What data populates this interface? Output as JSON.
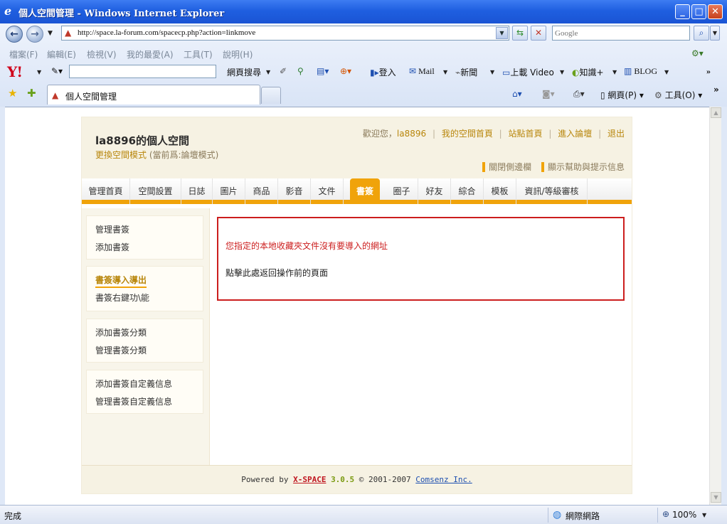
{
  "window": {
    "title": "個人空間管理 - Windows Internet Explorer"
  },
  "address": {
    "url": "http://space.la-forum.com/spacecp.php?action=linkmove",
    "search_placeholder": "Google"
  },
  "menu": {
    "items": [
      "檔案(F)",
      "編輯(E)",
      "檢視(V)",
      "我的最愛(A)",
      "工具(T)",
      "說明(H)"
    ]
  },
  "yahoo_toolbar": {
    "logo": "Y!",
    "web_search": "網頁搜尋",
    "signin": "登入",
    "mail": "Mail",
    "news": "新聞",
    "video": "上載 Video",
    "knowledge": "知識+",
    "blog": "BLOG",
    "more": "»"
  },
  "tabs": {
    "active_label": "個人空間管理",
    "page_cmd": "網頁(P)",
    "tools_cmd": "工具(O)"
  },
  "site": {
    "title": "la8896的個人空間",
    "change_mode": "更換空間模式",
    "current_mode": "(當前爲:論壇模式)",
    "greeting": "歡迎您，",
    "username": "la8896",
    "links": [
      "我的空間首頁",
      "站點首頁",
      "進入論壇",
      "退出"
    ],
    "toggles": [
      "關閉側邊欄",
      "顯示幫助與提示信息"
    ],
    "nav": [
      "管理首頁",
      "空間設置",
      "日誌",
      "圖片",
      "商品",
      "影音",
      "文件",
      "書簽",
      "圈子",
      "好友",
      "綜合",
      "模板",
      "資訊/等級審核"
    ],
    "nav_active_index": 7,
    "sidebar_groups": [
      {
        "items": [
          "管理書簽",
          "添加書簽"
        ]
      },
      {
        "items": [
          "書簽導入導出",
          "書簽右鍵功\\能"
        ]
      },
      {
        "items": [
          "添加書簽分類",
          "管理書簽分類"
        ]
      },
      {
        "items": [
          "添加書簽自定義信息",
          "管理書簽自定義信息"
        ]
      }
    ],
    "sidebar_current": "書簽導入導出",
    "message": {
      "error": "您指定的本地收藏夾文件沒有要導入的網址",
      "back": "點擊此處返回操作前的頁面"
    },
    "footer": {
      "powered": "Powered by ",
      "brand": "X-SPACE",
      "version": "3.0.5",
      "copyright": " © 2001-2007 ",
      "company": "Comsenz Inc."
    }
  },
  "status": {
    "text": "完成",
    "zone": "網際網路",
    "zoom": "100%"
  },
  "colors": {
    "accent": "#f0a30a",
    "error": "#cc1e1e",
    "link_gold": "#b8860b"
  }
}
